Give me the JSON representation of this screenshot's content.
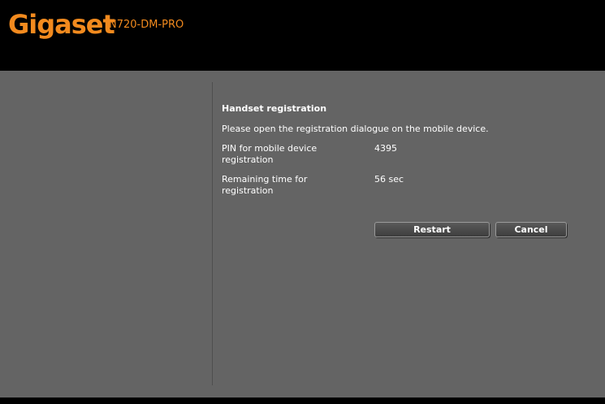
{
  "header": {
    "logo_text": "Gigaset",
    "model": "N720-DM-PRO"
  },
  "registration": {
    "title": "Handset registration",
    "instruction": "Please open the registration dialogue on the mobile device.",
    "pin_label": "PIN for mobile device registration",
    "pin_value": "4395",
    "time_label": "Remaining time for registration",
    "time_value": "56 sec"
  },
  "buttons": {
    "restart": "Restart",
    "cancel": "Cancel"
  },
  "colors": {
    "brand": "#f28a1e",
    "panel": "#646464",
    "header": "#000000"
  }
}
